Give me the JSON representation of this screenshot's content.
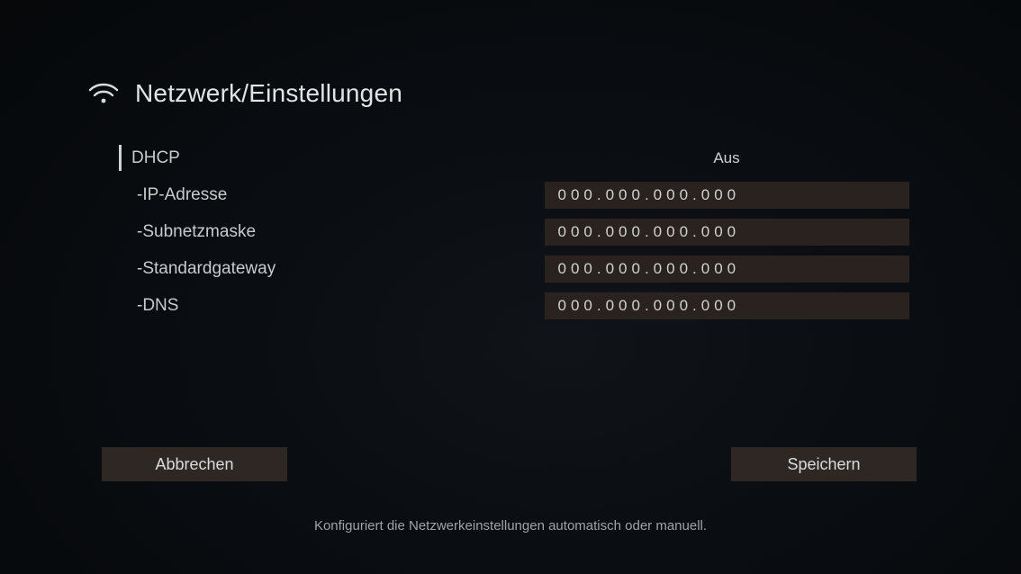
{
  "header": {
    "title": "Netzwerk/Einstellungen"
  },
  "settings": {
    "dhcp": {
      "label": "DHCP",
      "value": "Aus"
    },
    "ip": {
      "label": "-IP-Adresse",
      "value": "000.000.000.000"
    },
    "mask": {
      "label": "-Subnetzmaske",
      "value": "000.000.000.000"
    },
    "gw": {
      "label": "-Standardgateway",
      "value": "000.000.000.000"
    },
    "dns": {
      "label": "-DNS",
      "value": "000.000.000.000"
    }
  },
  "buttons": {
    "cancel": "Abbrechen",
    "save": "Speichern"
  },
  "footer": {
    "hint": "Konfiguriert die Netzwerkeinstellungen automatisch oder manuell."
  }
}
